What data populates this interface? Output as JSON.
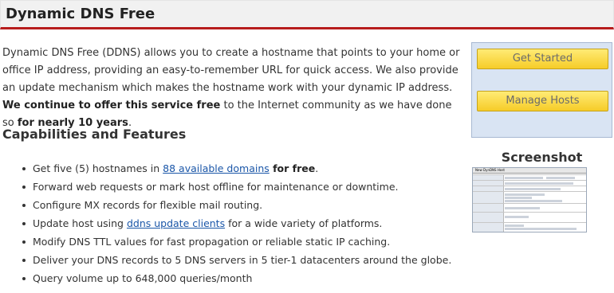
{
  "page": {
    "title": "Dynamic DNS Free"
  },
  "intro": {
    "text_1": "Dynamic DNS Free (DDNS) allows you to create a hostname that points to your home or office IP address, providing an easy-to-remember URL for quick access. We also provide an update mechanism which makes the hostname work with your dynamic IP address. ",
    "bold_1": "We continue to offer this service free",
    "text_2": " to the Internet community as we have done so ",
    "bold_2": "for nearly 10 years",
    "text_3": "."
  },
  "capabilities": {
    "heading": "Capabilities and Features",
    "items": [
      {
        "before": "Get five (5) hostnames in ",
        "link": "88 available domains",
        "bold": " for free",
        "after": "."
      },
      {
        "text": "Forward web requests or mark host offline for maintenance or downtime."
      },
      {
        "text": "Configure MX records for flexible mail routing."
      },
      {
        "before": "Update host using ",
        "link": "ddns update clients",
        "after": " for a wide variety of platforms."
      },
      {
        "text": "Modify DNS TTL values for fast propagation or reliable static IP caching."
      },
      {
        "text": "Deliver your DNS records to 5 DNS servers in 5 tier-1 datacenters around the globe."
      },
      {
        "text": "Query volume up to 648,000 queries/month"
      }
    ]
  },
  "sidebar": {
    "get_started": "Get Started",
    "manage_hosts": "Manage Hosts",
    "screenshot_label": "Screenshot",
    "thumb_title": "New DynDNS Host"
  }
}
